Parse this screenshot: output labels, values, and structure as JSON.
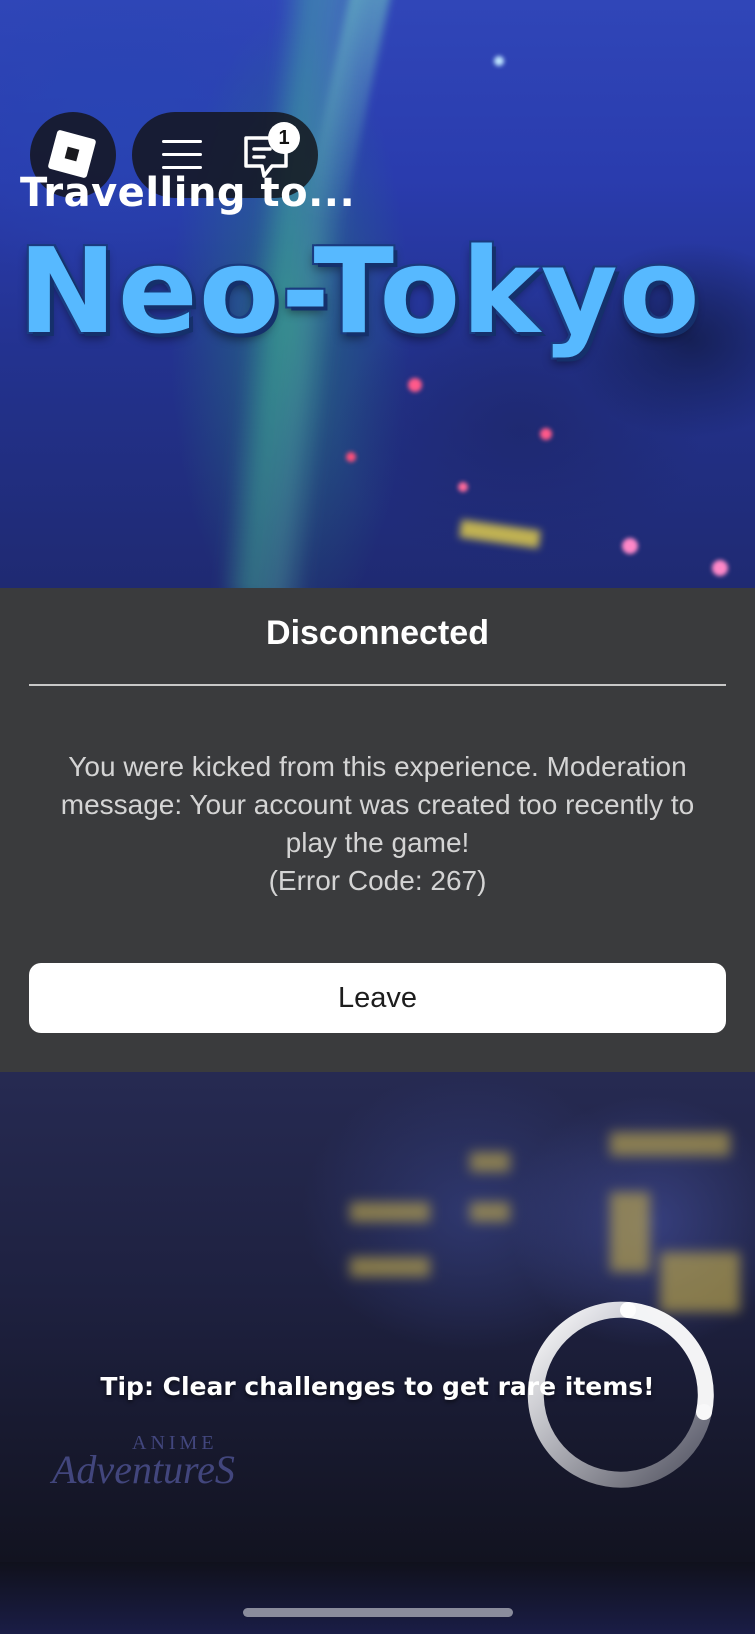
{
  "topbar": {
    "roblox_icon": "roblox-logo-icon",
    "menu_icon": "hamburger-menu-icon",
    "chat_icon": "chat-icon",
    "chat_badge_count": "1"
  },
  "loading": {
    "travel_text": "Travelling to...",
    "destination": "Neo-Tokyo",
    "tip": "Tip: Clear challenges to get rare items!",
    "game_logo_top": "ANIME",
    "game_logo_bottom": "AdventureS"
  },
  "dialog": {
    "title": "Disconnected",
    "message": "You were kicked from this experience. Moderation message:  Your account was created too recently to play the game!",
    "error_code": "(Error Code: 267)",
    "leave_label": "Leave"
  },
  "colors": {
    "dialog_bg": "#3a3b3d",
    "title_blue": "#57b9ff",
    "button_bg": "#ffffff"
  }
}
